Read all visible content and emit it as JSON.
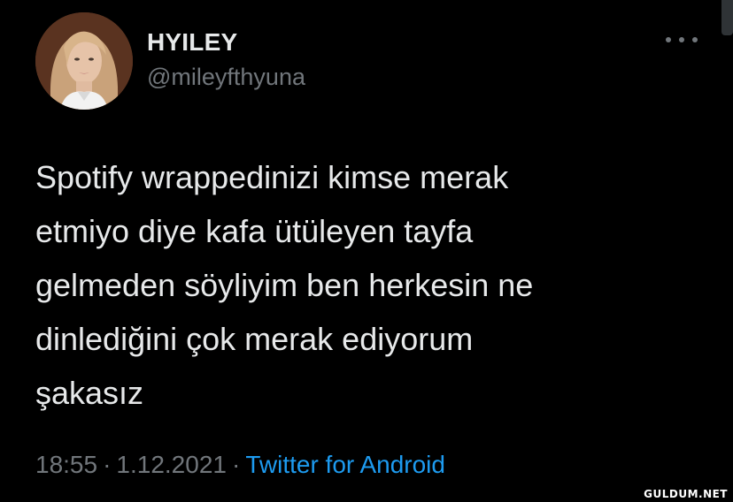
{
  "tweet": {
    "display_name": "HYILEY",
    "handle": "@mileyfthyuna",
    "avatar_icon": "user-avatar-photo",
    "text_lines": [
      "Spotify wrappedinizi kimse merak",
      "etmiyo diye kafa ütüleyen tayfa",
      "gelmeden söyliyim ben herkesin ne",
      "dinlediğini çok merak ediyorum",
      "şakasız"
    ],
    "time": "18:55",
    "date": "1.12.2021",
    "separator": "·",
    "source": "Twitter for Android",
    "more_icon": "more-options-icon"
  },
  "watermark": "GULDUM.NET",
  "colors": {
    "background": "#000000",
    "primary_text": "#e7e9ea",
    "secondary_text": "#71767b",
    "link": "#1d9bf0"
  }
}
